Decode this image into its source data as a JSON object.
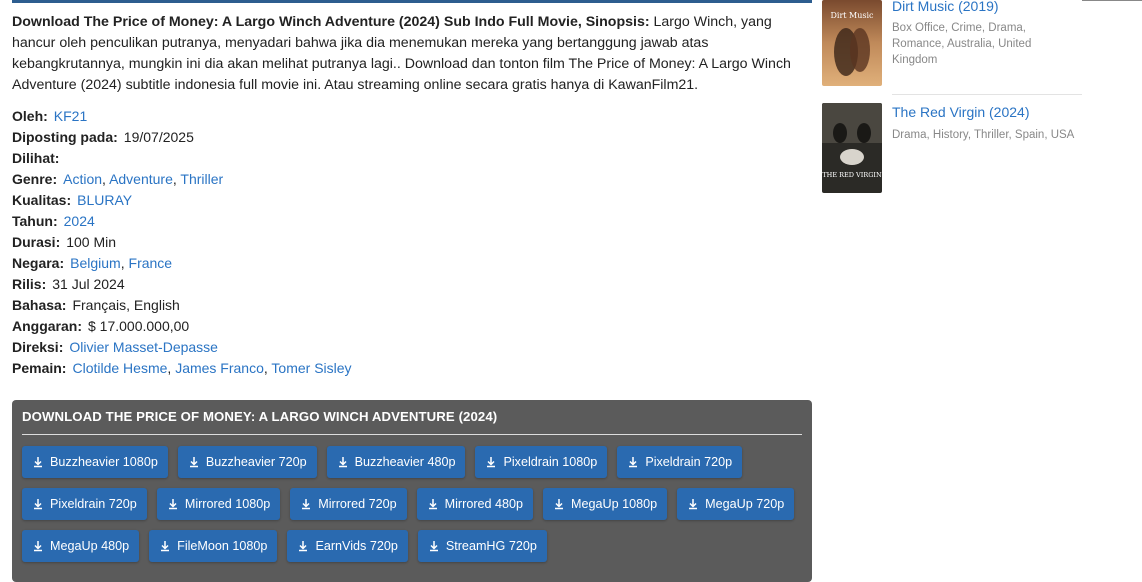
{
  "article": {
    "synopsis_bold": "Download The Price of Money: A Largo Winch Adventure (2024) Sub Indo Full Movie, Sinopsis:",
    "synopsis_text": " Largo Winch, yang hancur oleh penculikan putranya, menyadari bahwa jika dia menemukan mereka yang bertanggung jawab atas kebangkrutannya, mungkin ini dia akan melihat putranya lagi.. Download dan tonton film The Price of Money: A Largo Winch Adventure (2024) subtitle indonesia full movie ini. Atau streaming online secara gratis hanya di KawanFilm21."
  },
  "meta": {
    "oleh_label": "Oleh:",
    "oleh_value": "KF21",
    "diposting_label": "Diposting pada:",
    "diposting_value": "19/07/2025",
    "dilihat_label": "Dilihat:",
    "genre_label": "Genre:",
    "genres": [
      "Action",
      "Adventure",
      "Thriller"
    ],
    "kualitas_label": "Kualitas:",
    "kualitas_value": "BLURAY",
    "tahun_label": "Tahun:",
    "tahun_value": "2024",
    "durasi_label": "Durasi:",
    "durasi_value": "100 Min",
    "negara_label": "Negara:",
    "negara": [
      "Belgium",
      "France"
    ],
    "rilis_label": "Rilis:",
    "rilis_value": "31 Jul 2024",
    "bahasa_label": "Bahasa:",
    "bahasa_value": "Français, English",
    "anggaran_label": "Anggaran:",
    "anggaran_value": "$ 17.000.000,00",
    "direksi_label": "Direksi:",
    "direksi_value": "Olivier Masset-Depasse",
    "pemain_label": "Pemain:",
    "pemain": [
      "Clotilde Hesme",
      "James Franco",
      "Tomer Sisley"
    ]
  },
  "download": {
    "title": "DOWNLOAD THE PRICE OF MONEY: A LARGO WINCH ADVENTURE (2024)",
    "rows": [
      [
        "Buzzheavier 1080p",
        "Buzzheavier 720p",
        "Buzzheavier 480p",
        "Pixeldrain 1080p",
        "Pixeldrain 720p"
      ],
      [
        "Pixeldrain 720p",
        "Mirrored 1080p",
        "Mirrored 720p",
        "Mirrored 480p",
        "MegaUp 1080p",
        "MegaUp 720p"
      ],
      [
        "MegaUp 480p",
        "FileMoon 1080p",
        "EarnVids 720p",
        "StreamHG 720p"
      ]
    ],
    "icon": "download-icon",
    "button_color": "#2a6ab0"
  },
  "sidebar": {
    "items": [
      {
        "title": "Dirt Music (2019)",
        "meta": "Box Office, Crime, Drama, Romance, Australia, United Kingdom",
        "poster_text": "Dirt Music"
      },
      {
        "title": "The Red Virgin (2024)",
        "meta": "Drama, History, Thriller, Spain, USA",
        "poster_text": "THE RED VIRGIN"
      }
    ]
  },
  "colors": {
    "link": "#2a74c4",
    "download_box": "#5b5b5b",
    "top_bar": "#2d5d8f"
  }
}
